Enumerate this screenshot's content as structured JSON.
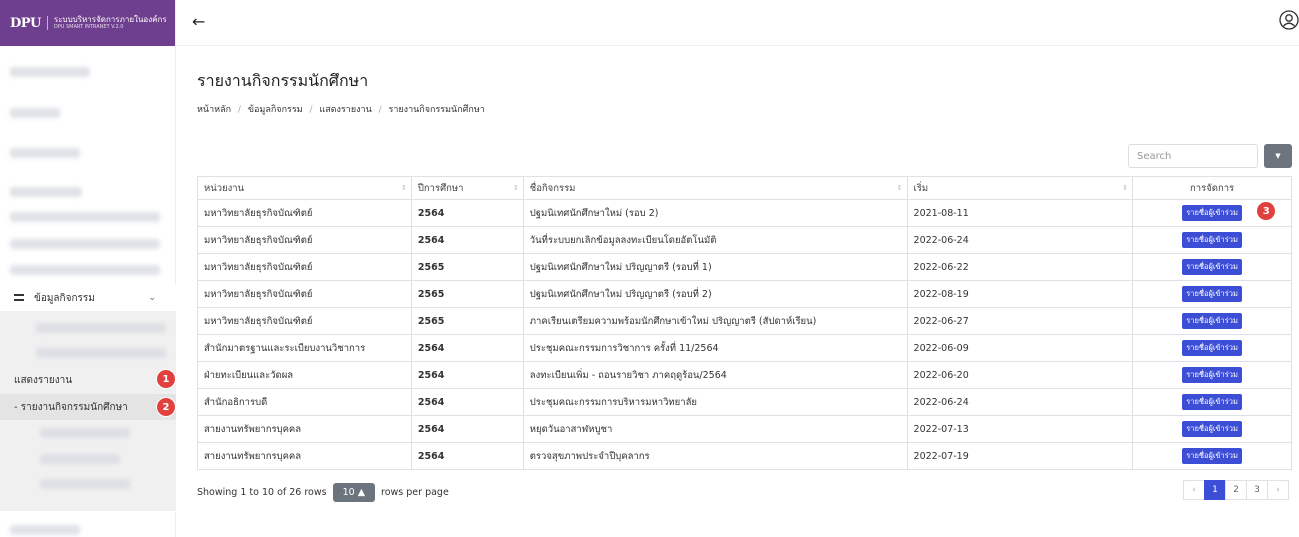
{
  "app": {
    "logo_text": "DPU",
    "title": "ระบบบริหารจัดการภายในองค์กร",
    "subtitle": "DPU SMART INTRANET V.2.0"
  },
  "sidebar": {
    "active_menu_label": "ข้อมูลกิจกรรม",
    "submenu": {
      "report_label": "แสดงรายงาน",
      "student_activity_report_label": "- รายงานกิจกรรมนักศึกษา"
    },
    "badges": [
      "1",
      "2"
    ]
  },
  "page": {
    "title": "รายงานกิจกรรมนักศึกษา",
    "breadcrumb": [
      "หน้าหลัก",
      "ข้อมูลกิจกรรม",
      "แสดงรายงาน",
      "รายงานกิจกรรมนักศึกษา"
    ],
    "breadcrumb_sep": "/"
  },
  "toolbar": {
    "search_placeholder": "Search",
    "dropdown_icon": "▼"
  },
  "table": {
    "headers": [
      "หน่วยงาน",
      "ปีการศึกษา",
      "ชื่อกิจกรรม",
      "เริ่ม",
      "การจัดการ"
    ],
    "action_label": "รายชื่อผู้เข้าร่วม",
    "action_badge": "3",
    "rows": [
      [
        "มหาวิทยาลัยธุรกิจบัณฑิตย์",
        "2564",
        "ปฐมนิเทศนักศึกษาใหม่ (รอบ 2)",
        "2021-08-11"
      ],
      [
        "มหาวิทยาลัยธุรกิจบัณฑิตย์",
        "2564",
        "วันที่ระบบยกเลิกข้อมูลลงทะเบียนโดยอัตโนมัติ",
        "2022-06-24"
      ],
      [
        "มหาวิทยาลัยธุรกิจบัณฑิตย์",
        "2565",
        "ปฐมนิเทศนักศึกษาใหม่ ปริญญาตรี (รอบที่ 1)",
        "2022-06-22"
      ],
      [
        "มหาวิทยาลัยธุรกิจบัณฑิตย์",
        "2565",
        "ปฐมนิเทศนักศึกษาใหม่ ปริญญาตรี (รอบที่ 2)",
        "2022-08-19"
      ],
      [
        "มหาวิทยาลัยธุรกิจบัณฑิตย์",
        "2565",
        "ภาคเรียนเตรียมความพร้อมนักศึกษาเข้าใหม่ ปริญญาตรี (สัปดาห์เรียน)",
        "2022-06-27"
      ],
      [
        "สำนักมาตรฐานและระเบียบงานวิชาการ",
        "2564",
        "ประชุมคณะกรรมการวิชาการ ครั้งที่ 11/2564",
        "2022-06-09"
      ],
      [
        "ฝ่ายทะเบียนและวัดผล",
        "2564",
        "ลงทะเบียนเพิ่ม - ถอนรายวิชา ภาคฤดูร้อน/2564",
        "2022-06-20"
      ],
      [
        "สำนักอธิการบดี",
        "2564",
        "ประชุมคณะกรรมการบริหารมหาวิทยาลัย",
        "2022-06-24"
      ],
      [
        "สายงานทรัพยากรบุคคล",
        "2564",
        "หยุดวันอาสาฬหบูชา",
        "2022-07-13"
      ],
      [
        "สายงานทรัพยากรบุคคล",
        "2564",
        "ตรวจสุขภาพประจำปีบุคลากร",
        "2022-07-19"
      ]
    ]
  },
  "footer": {
    "showing_text": "Showing 1 to 10 of 26 rows",
    "page_size": "10 ▲",
    "per_page_text": "rows per page",
    "pages": [
      "‹",
      "1",
      "2",
      "3",
      "›"
    ]
  }
}
